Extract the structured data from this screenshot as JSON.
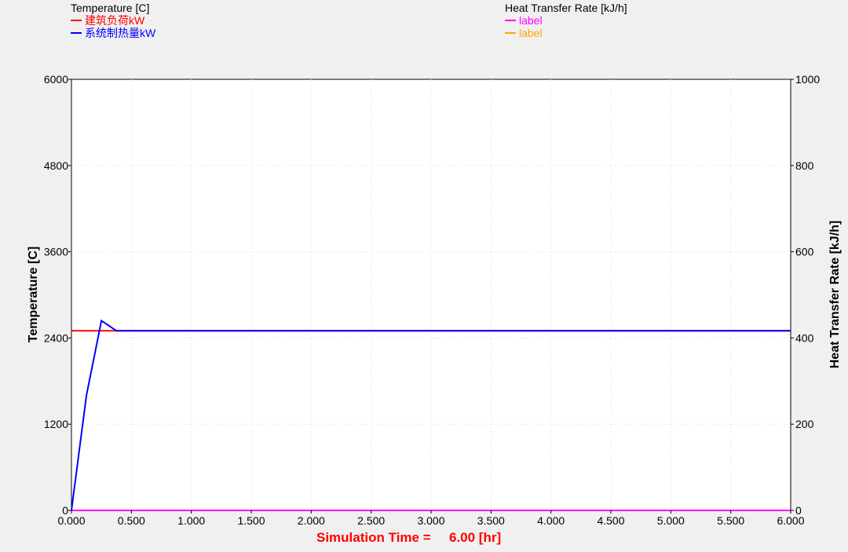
{
  "legend_left": {
    "title": "Temperature [C]",
    "entries": [
      {
        "label": "建筑负荷kW",
        "color": "#ff0000"
      },
      {
        "label": "系统制热量kW",
        "color": "#0000ff"
      }
    ]
  },
  "legend_right": {
    "title": "Heat Transfer Rate [kJ/h]",
    "entries": [
      {
        "label": "label",
        "color": "#ff00ff"
      },
      {
        "label": "label",
        "color": "#ffa500"
      }
    ]
  },
  "footer": {
    "label": "Simulation Time =",
    "value": "6.00 [hr]"
  },
  "chart_data": {
    "type": "line",
    "ylabel": "Temperature [C]",
    "y2label": "Heat Transfer Rate [kJ/h]",
    "xlim": [
      0,
      6
    ],
    "ylim": [
      0,
      6000
    ],
    "y2lim": [
      0,
      1000
    ],
    "x_ticks": [
      "0.000",
      "0.500",
      "1.000",
      "1.500",
      "2.000",
      "2.500",
      "3.000",
      "3.500",
      "4.000",
      "4.500",
      "5.000",
      "5.500",
      "6.000"
    ],
    "y_ticks": [
      "0",
      "1200",
      "2400",
      "3600",
      "4800",
      "6000"
    ],
    "y2_ticks": [
      "0",
      "200",
      "400",
      "600",
      "800",
      "1000"
    ],
    "grid": true,
    "series": [
      {
        "name": "建筑负荷kW",
        "axis": "left",
        "color": "#ff0000",
        "x": [
          0,
          0.25,
          0.5,
          6
        ],
        "y": [
          2500,
          2500,
          2500,
          2500
        ]
      },
      {
        "name": "系统制热量kW",
        "axis": "left",
        "color": "#0000ff",
        "x": [
          0,
          0.125,
          0.25,
          0.375,
          0.5,
          6
        ],
        "y": [
          0,
          1600,
          2640,
          2500,
          2500,
          2500
        ]
      },
      {
        "name": "label",
        "axis": "right",
        "color": "#ff00ff",
        "x": [
          0,
          6
        ],
        "y": [
          0,
          0
        ]
      },
      {
        "name": "label",
        "axis": "right",
        "color": "#ffa500",
        "x": [
          0,
          6
        ],
        "y": [
          0,
          0
        ]
      }
    ]
  }
}
